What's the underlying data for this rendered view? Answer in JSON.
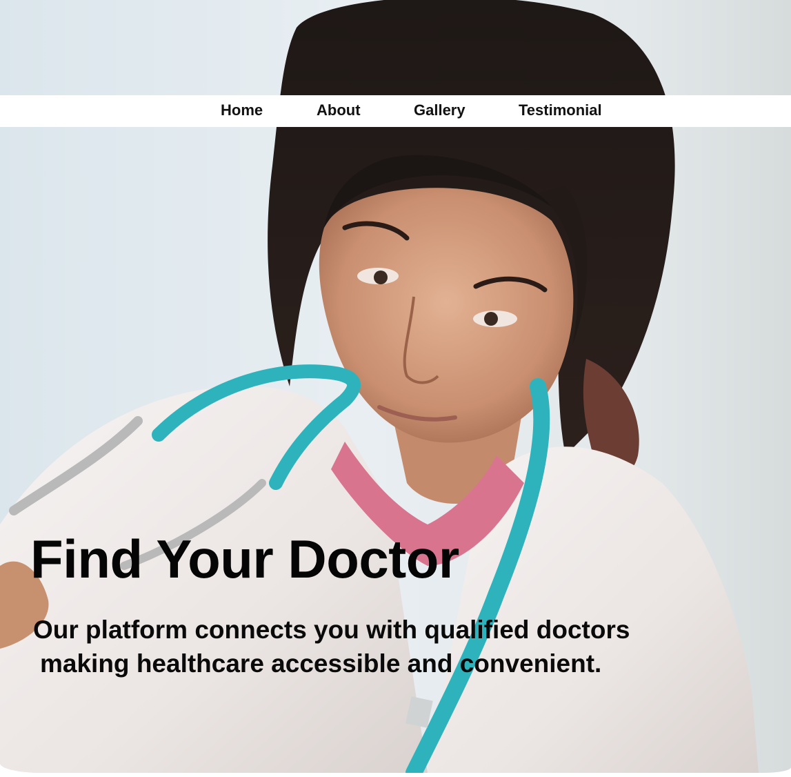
{
  "nav": {
    "items": [
      {
        "label": "Home"
      },
      {
        "label": "About"
      },
      {
        "label": "Gallery"
      },
      {
        "label": "Testimonial"
      }
    ]
  },
  "hero": {
    "title": "Find Your Doctor",
    "text_line1": "Our platform connects you with qualified doctors",
    "text_line2": "making healthcare accessible and convenient.",
    "image": "doctor-photo"
  },
  "colors": {
    "text": "#111111",
    "navbar_bg": "#ffffff",
    "stethoscope": "#2eb3bd",
    "coat": "#f3efee",
    "scrubs": "#d9748f"
  }
}
